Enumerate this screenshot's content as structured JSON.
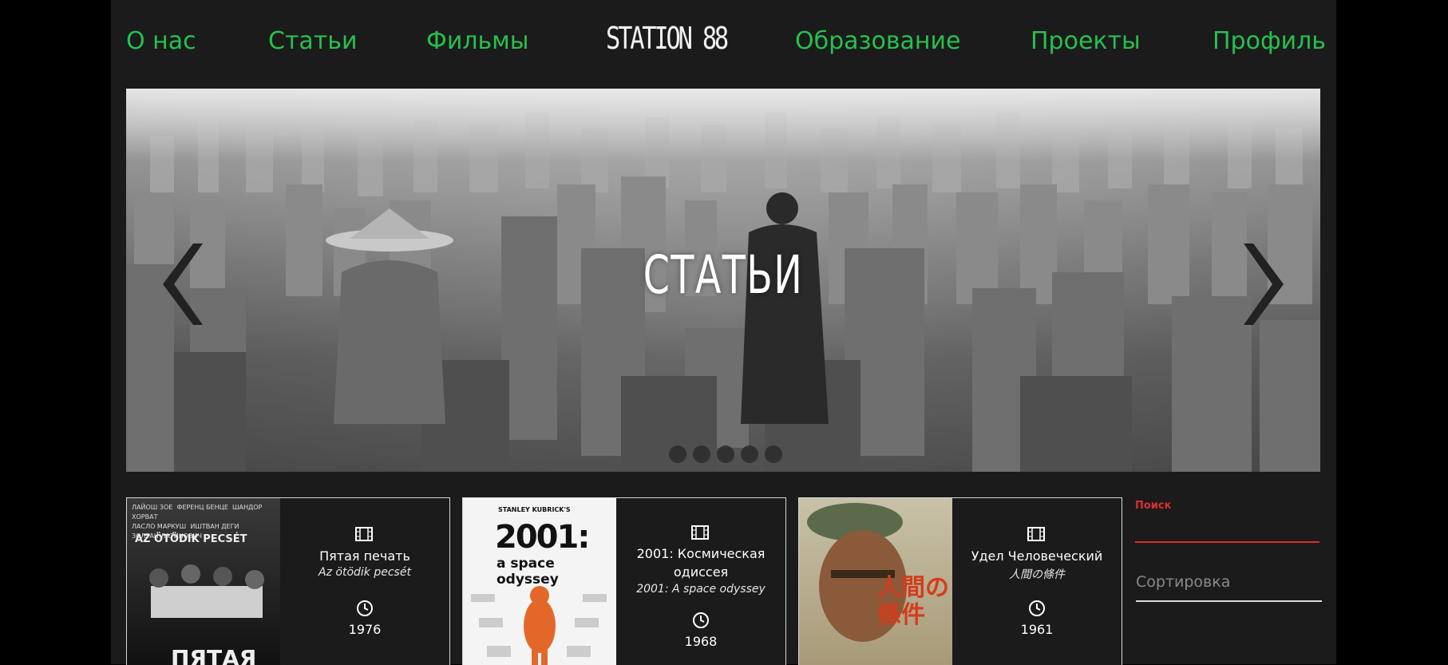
{
  "nav": {
    "items": [
      "О нас",
      "Статьи",
      "Фильмы",
      "Образование",
      "Проекты",
      "Профиль"
    ],
    "logo": "STATION 88"
  },
  "hero": {
    "title": "СТАТЬИ",
    "slide_count": 5
  },
  "cards": [
    {
      "title": "Пятая печать",
      "original": "Az ötödik pecsét",
      "year": "1976",
      "poster_text": "ПЯТАЯ",
      "poster_subtitle": "AZ ÖTÖDIK PECSÉT",
      "poster_credits": [
        "ЛАЙОШ ЗОЕ",
        "ФЕРЕНЦ БЕНЦЕ",
        "ШАНДОР ХОРВАТ",
        "ЛАСЛО МАРКУШ",
        "ИШТВАН ДЕГИ",
        "ЗОЛТАН ЛАТИНОВИЧ"
      ]
    },
    {
      "title": "2001: Космическая одиссея",
      "original": "2001: A space odyssey",
      "year": "1968",
      "poster_text": "2001:",
      "poster_subtitle": "a space odyssey",
      "poster_credits": [
        "STANLEY KUBRICK'S"
      ]
    },
    {
      "title": "Удел Человеческий",
      "original": "人間の條件",
      "year": "1961",
      "poster_text": "人間の條件",
      "poster_subtitle": "",
      "poster_credits": []
    }
  ],
  "search": {
    "label": "Поиск",
    "value": ""
  },
  "sort": {
    "label": "Сортировка"
  },
  "colors": {
    "accent": "#27c04f",
    "search": "#d93030",
    "background": "#1b1b1b"
  },
  "icons": {
    "film": "film-icon",
    "clock": "clock-icon",
    "prev": "chevron-left-icon",
    "next": "chevron-right-icon"
  }
}
